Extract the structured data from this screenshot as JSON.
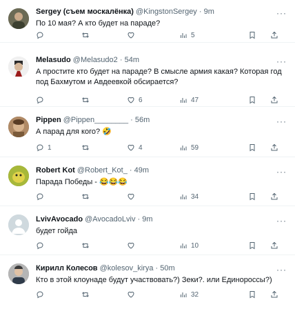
{
  "colors": {
    "text": "#0f1419",
    "muted": "#536471",
    "border": "#eff3f4"
  },
  "tweets": [
    {
      "name": "Sergey (съем москалёнка)",
      "handle": "@KingstonSergey",
      "time": "9m",
      "text": "По 10 мая? А кто будет на параде?",
      "replies": "",
      "retweets": "",
      "likes": "",
      "views": "5"
    },
    {
      "name": "Melasudo",
      "handle": "@Melasudo2",
      "time": "54m",
      "text": "А простите кто будет на параде? В смысле армия какая? Которая год под Бахмутом и Авдеевкой обсирается?",
      "replies": "",
      "retweets": "",
      "likes": "6",
      "views": "47"
    },
    {
      "name": "Pippen",
      "handle": "@Pippen________",
      "time": "56m",
      "text": "А парад для кого? 🤣",
      "replies": "1",
      "retweets": "",
      "likes": "4",
      "views": "59"
    },
    {
      "name": "Robert Kot",
      "handle": "@Robert_Kot_",
      "time": "49m",
      "text": "Парада Победы - 😂😂😂",
      "replies": "",
      "retweets": "",
      "likes": "",
      "views": "34"
    },
    {
      "name": "LvivAvocado",
      "handle": "@AvocadoLviv",
      "time": "9m",
      "text": "будет гойда",
      "replies": "",
      "retweets": "",
      "likes": "",
      "views": "10"
    },
    {
      "name": "Кирилл Колесов",
      "handle": "@kolesov_kirya",
      "time": "50m",
      "text": "Кто в этой клоунаде будут участвовать?) Зеки?. или Единороссы?)",
      "replies": "",
      "retweets": "",
      "likes": "",
      "views": "32"
    }
  ],
  "icons": {
    "more": "more-horizontal-icon",
    "reply": "reply-icon",
    "retweet": "retweet-icon",
    "like": "heart-icon",
    "views": "views-icon",
    "bookmark": "bookmark-icon",
    "share": "share-icon"
  }
}
